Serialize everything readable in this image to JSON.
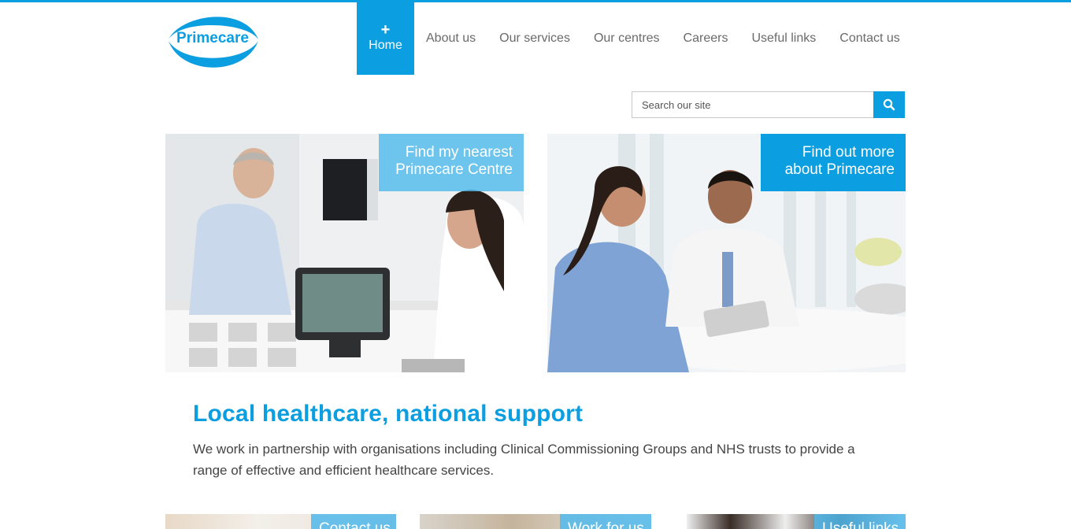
{
  "brand": {
    "name": "Primecare",
    "color": "#0b9ee0"
  },
  "nav": {
    "home_icon": "+",
    "items": [
      {
        "label": "Home",
        "active": true
      },
      {
        "label": "About us"
      },
      {
        "label": "Our services"
      },
      {
        "label": "Our centres"
      },
      {
        "label": "Careers"
      },
      {
        "label": "Useful links"
      },
      {
        "label": "Contact us"
      }
    ]
  },
  "search": {
    "placeholder": "Search our site",
    "icon": "search-icon"
  },
  "features": [
    {
      "label_line1": "Find my nearest",
      "label_line2": "Primecare Centre"
    },
    {
      "label_line1": "Find out more",
      "label_line2": "about Primecare"
    }
  ],
  "intro": {
    "title": "Local healthcare, national support",
    "text": "We work in partnership with organisations including Clinical Commissioning Groups and NHS trusts to provide a range of effective and efficient healthcare services."
  },
  "bottom_tiles": [
    {
      "label": "Contact us"
    },
    {
      "label": "Work for us"
    },
    {
      "label": "Useful links"
    }
  ]
}
